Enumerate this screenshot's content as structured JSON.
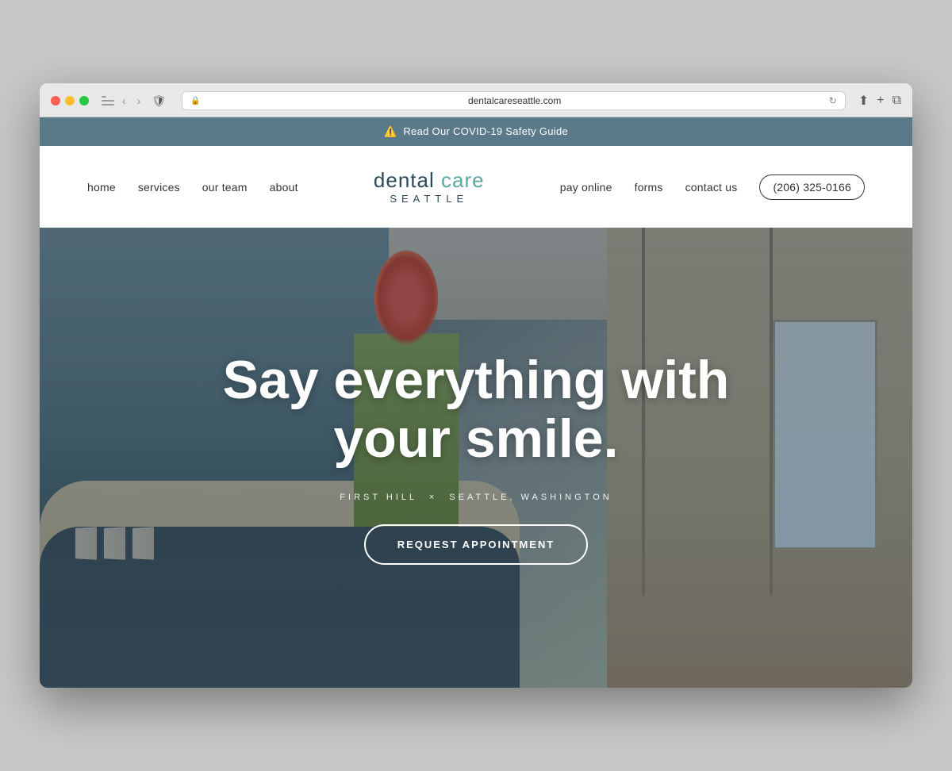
{
  "browser": {
    "url": "dentalcareseattle.com",
    "shield_icon": "🛡",
    "lock_icon": "🔒"
  },
  "covid_banner": {
    "text": "Read Our COVID-19 Safety Guide",
    "icon": "⚠️"
  },
  "nav": {
    "left_links": [
      {
        "label": "home",
        "id": "home"
      },
      {
        "label": "services",
        "id": "services"
      },
      {
        "label": "our team",
        "id": "our-team"
      },
      {
        "label": "about",
        "id": "about"
      }
    ],
    "logo": {
      "dental": "dental",
      "care": "care",
      "seattle": "SEATTLE"
    },
    "right_links": [
      {
        "label": "pay online",
        "id": "pay-online"
      },
      {
        "label": "forms",
        "id": "forms"
      },
      {
        "label": "contact us",
        "id": "contact-us"
      }
    ],
    "phone": "(206) 325-0166"
  },
  "hero": {
    "headline": "Say everything with your smile.",
    "location_part1": "FIRST HILL",
    "separator": "×",
    "location_part2": "SEATTLE, WASHINGTON",
    "cta_button": "REQUEST APPOINTMENT"
  }
}
